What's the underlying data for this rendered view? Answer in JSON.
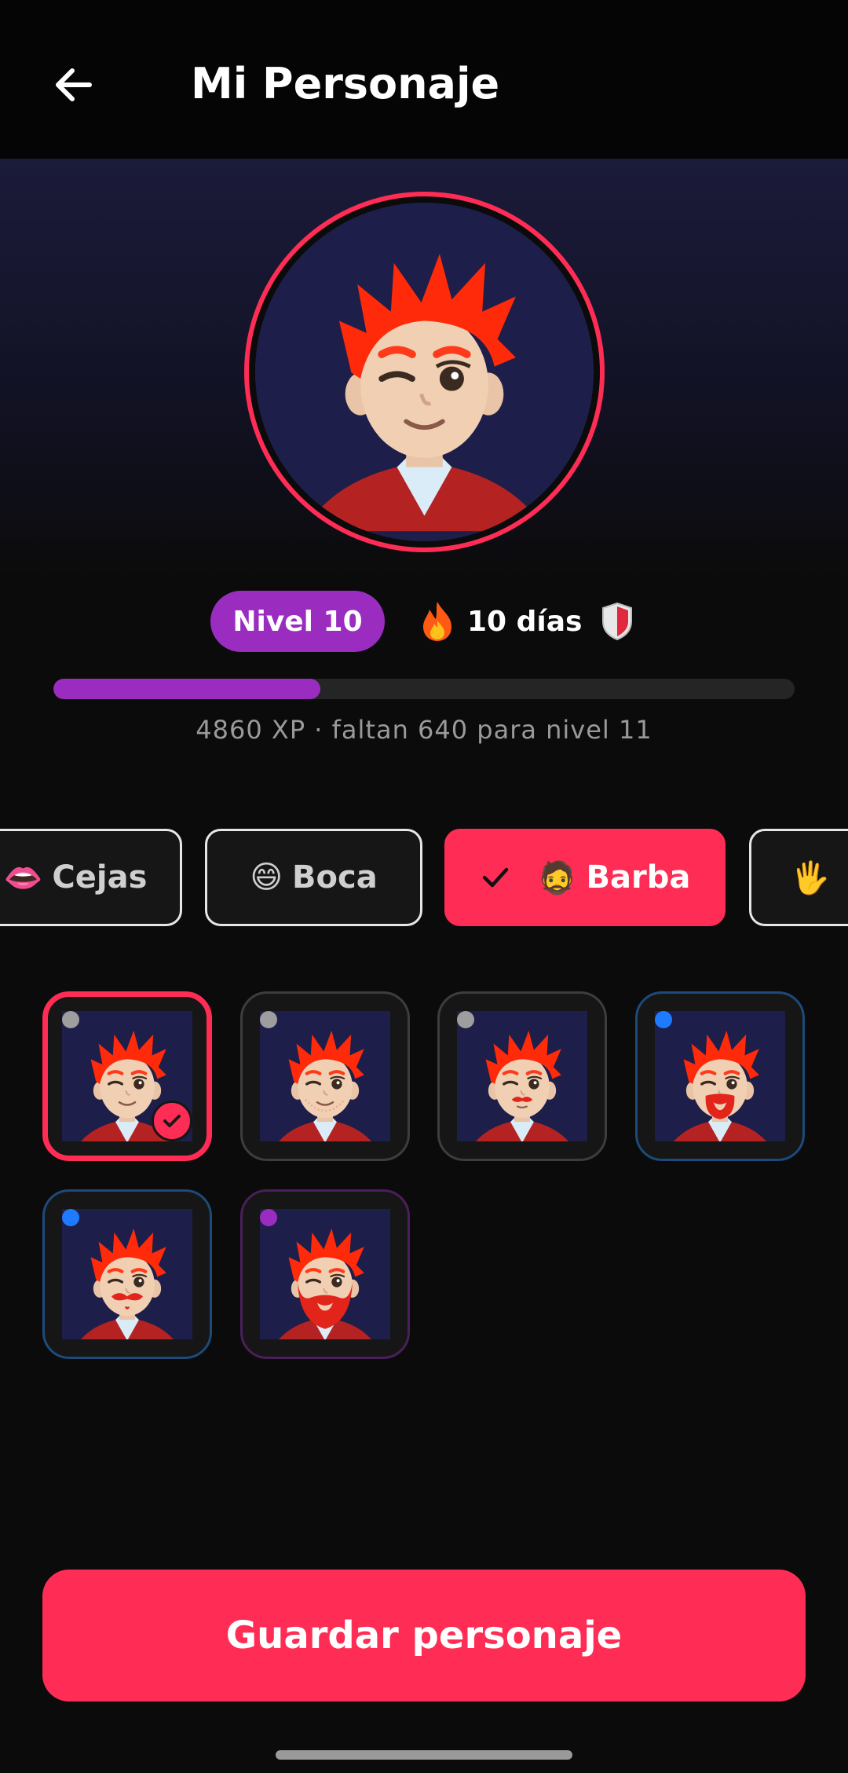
{
  "header": {
    "title": "Mi Personaje",
    "back_icon": "arrow-left-icon"
  },
  "profile": {
    "level_label": "Nivel 10",
    "streak_icon": "fire-icon",
    "streak_label": "10 días",
    "shield_icon": "shield-icon",
    "progress_fraction": 0.36,
    "xp_text": "4860 XP · faltan 640 para nivel 11"
  },
  "categories": [
    {
      "emoji": "👄",
      "label": "Cejas",
      "selected": false
    },
    {
      "emoji": "😄",
      "label": "Boca",
      "selected": false
    },
    {
      "emoji": "🧔",
      "label": "Barba",
      "selected": true
    },
    {
      "emoji": "🖐",
      "label": "",
      "selected": false
    }
  ],
  "options": [
    {
      "variant": "none",
      "rarity_color": "#9e9e9e",
      "selected": true
    },
    {
      "variant": "stubble",
      "rarity_color": "#9e9e9e",
      "selected": false
    },
    {
      "variant": "mustache",
      "rarity_color": "#9e9e9e",
      "selected": false
    },
    {
      "variant": "goatee",
      "rarity_color": "#1e7bff",
      "selected": false
    },
    {
      "variant": "handlebar",
      "rarity_color": "#1e7bff",
      "selected": false
    },
    {
      "variant": "full-beard",
      "rarity_color": "#9b2cc0",
      "selected": false
    }
  ],
  "actions": {
    "save_label": "Guardar personaje"
  },
  "colors": {
    "accent": "#ff2d55",
    "level": "#9b2cc0",
    "avatar_bg": "#1e1e4a",
    "hair": "#ff2a0a"
  }
}
